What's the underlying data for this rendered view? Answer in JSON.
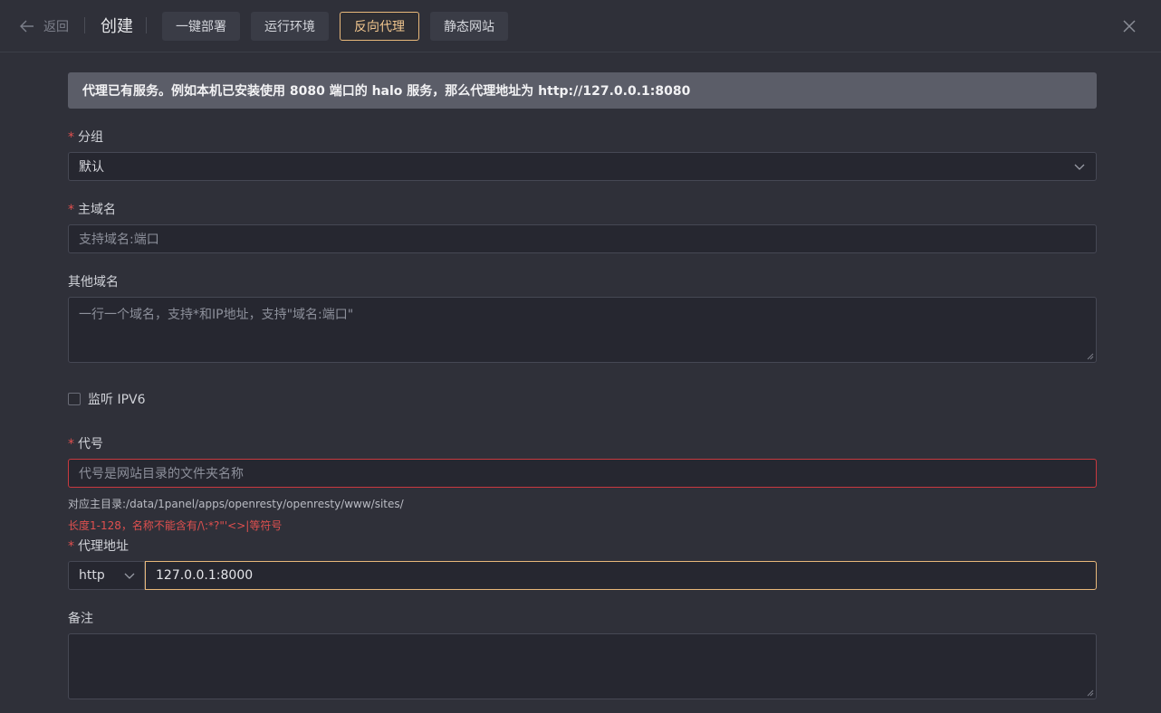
{
  "header": {
    "back_label": "返回",
    "title": "创建",
    "tabs": [
      {
        "label": "一键部署",
        "active": false
      },
      {
        "label": "运行环境",
        "active": false
      },
      {
        "label": "反向代理",
        "active": true
      },
      {
        "label": "静态网站",
        "active": false
      }
    ]
  },
  "alert": {
    "text": "代理已有服务。例如本机已安装使用 8080 端口的 halo 服务，那么代理地址为 http://127.0.0.1:8080"
  },
  "form": {
    "group": {
      "label": "分组",
      "value": "默认"
    },
    "primary_domain": {
      "label": "主域名",
      "placeholder": "支持域名:端口"
    },
    "other_domains": {
      "label": "其他域名",
      "placeholder": "一行一个域名，支持*和IP地址，支持\"域名:端口\""
    },
    "ipv6": {
      "label": "监听 IPV6",
      "checked": false
    },
    "alias": {
      "label": "代号",
      "placeholder": "代号是网站目录的文件夹名称",
      "hint": "对应主目录:/data/1panel/apps/openresty/openresty/www/sites/",
      "error": "长度1-128，名称不能含有/\\:*?\"'<>|等符号"
    },
    "proxy": {
      "label": "代理地址",
      "protocol": "http",
      "address": "127.0.0.1:8000"
    },
    "remark": {
      "label": "备注",
      "value": ""
    }
  },
  "colors": {
    "accent": "#e8b87a",
    "error": "#e0504f",
    "background": "#2f3039"
  }
}
